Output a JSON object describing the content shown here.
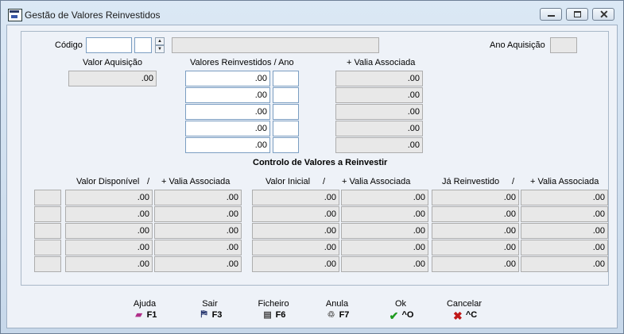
{
  "window": {
    "title": "Gestão de Valores Reinvestidos"
  },
  "header": {
    "codigo_label": "Código",
    "ano_aquisicao_label": "Ano Aquisição",
    "valor_aquisicao_label": "Valor Aquisição",
    "valor_aquisicao_value": ".00",
    "valores_reinvestidos_label": "Valores Reinvestidos / Ano",
    "mais_valia_label": "+ Valia Associada"
  },
  "reinvest_rows": [
    {
      "valor": ".00",
      "ano": "",
      "valia": ".00"
    },
    {
      "valor": ".00",
      "ano": "",
      "valia": ".00"
    },
    {
      "valor": ".00",
      "ano": "",
      "valia": ".00"
    },
    {
      "valor": ".00",
      "ano": "",
      "valia": ".00"
    },
    {
      "valor": ".00",
      "ano": "",
      "valia": ".00"
    }
  ],
  "controlo": {
    "title": "Controlo de Valores a Reinvestir",
    "valor_disponivel": "Valor Disponível",
    "valor_inicial": "Valor Inicial",
    "ja_reinvestido": "Já Reinvestido",
    "slash": "/",
    "mais_valia": "+ Valia Associada",
    "rows": [
      [
        ".00",
        ".00",
        ".00",
        ".00",
        ".00",
        ".00"
      ],
      [
        ".00",
        ".00",
        ".00",
        ".00",
        ".00",
        ".00"
      ],
      [
        ".00",
        ".00",
        ".00",
        ".00",
        ".00",
        ".00"
      ],
      [
        ".00",
        ".00",
        ".00",
        ".00",
        ".00",
        ".00"
      ],
      [
        ".00",
        ".00",
        ".00",
        ".00",
        ".00",
        ".00"
      ]
    ]
  },
  "footer": {
    "ajuda": {
      "label": "Ajuda",
      "key": "F1",
      "icon": "book-icon"
    },
    "sair": {
      "label": "Sair",
      "key": "F3",
      "icon": "exit-door-icon"
    },
    "ficheiro": {
      "label": "Ficheiro",
      "key": "F6",
      "icon": "cabinet-icon"
    },
    "anula": {
      "label": "Anula",
      "key": "F7",
      "icon": "trash-icon"
    },
    "ok": {
      "label": "Ok",
      "key": "^O",
      "icon": "checkmark-icon"
    },
    "cancelar": {
      "label": "Cancelar",
      "key": "^C",
      "icon": "x-mark-icon"
    }
  }
}
